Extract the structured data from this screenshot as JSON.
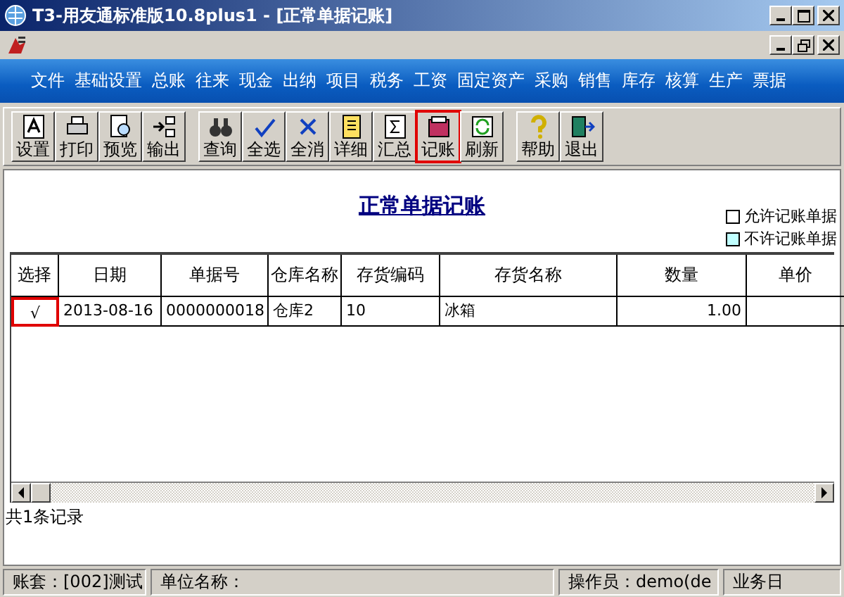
{
  "window": {
    "title": "T3-用友通标准版10.8plus1 - [正常单据记账]"
  },
  "menu": [
    "文件",
    "基础设置",
    "总账",
    "往来",
    "现金",
    "出纳",
    "项目",
    "税务",
    "工资",
    "固定资产",
    "采购",
    "销售",
    "库存",
    "核算",
    "生产",
    "票据"
  ],
  "toolbar": [
    [
      {
        "label": "设置",
        "highlighted": false
      },
      {
        "label": "打印",
        "highlighted": false
      },
      {
        "label": "预览",
        "highlighted": false
      },
      {
        "label": "输出",
        "highlighted": false
      }
    ],
    [
      {
        "label": "查询",
        "highlighted": false
      },
      {
        "label": "全选",
        "highlighted": false
      },
      {
        "label": "全消",
        "highlighted": false
      },
      {
        "label": "详细",
        "highlighted": false
      },
      {
        "label": "汇总",
        "highlighted": false
      },
      {
        "label": "记账",
        "highlighted": true
      },
      {
        "label": "刷新",
        "highlighted": false
      }
    ],
    [
      {
        "label": "帮助",
        "highlighted": false
      },
      {
        "label": "退出",
        "highlighted": false
      }
    ]
  ],
  "heading": "正常单据记账",
  "legend": [
    {
      "label": "允许记账单据",
      "color": "#ffffff"
    },
    {
      "label": "不许记账单据",
      "color": "#c0ffff"
    }
  ],
  "table": {
    "columns": [
      "选择",
      "日期",
      "单据号",
      "仓库名称",
      "存货编码",
      "存货名称",
      "数量",
      "单价"
    ],
    "rows": [
      {
        "cells": [
          "√",
          "2013-08-16",
          "0000000018",
          "仓库2",
          "10",
          "冰箱",
          "1.00"
        ],
        "selected": true
      }
    ]
  },
  "record_count": "共1条记录",
  "status_bar": [
    "账套：[002]测试",
    "单位名称：",
    "操作员：demo(de",
    "业务日"
  ]
}
